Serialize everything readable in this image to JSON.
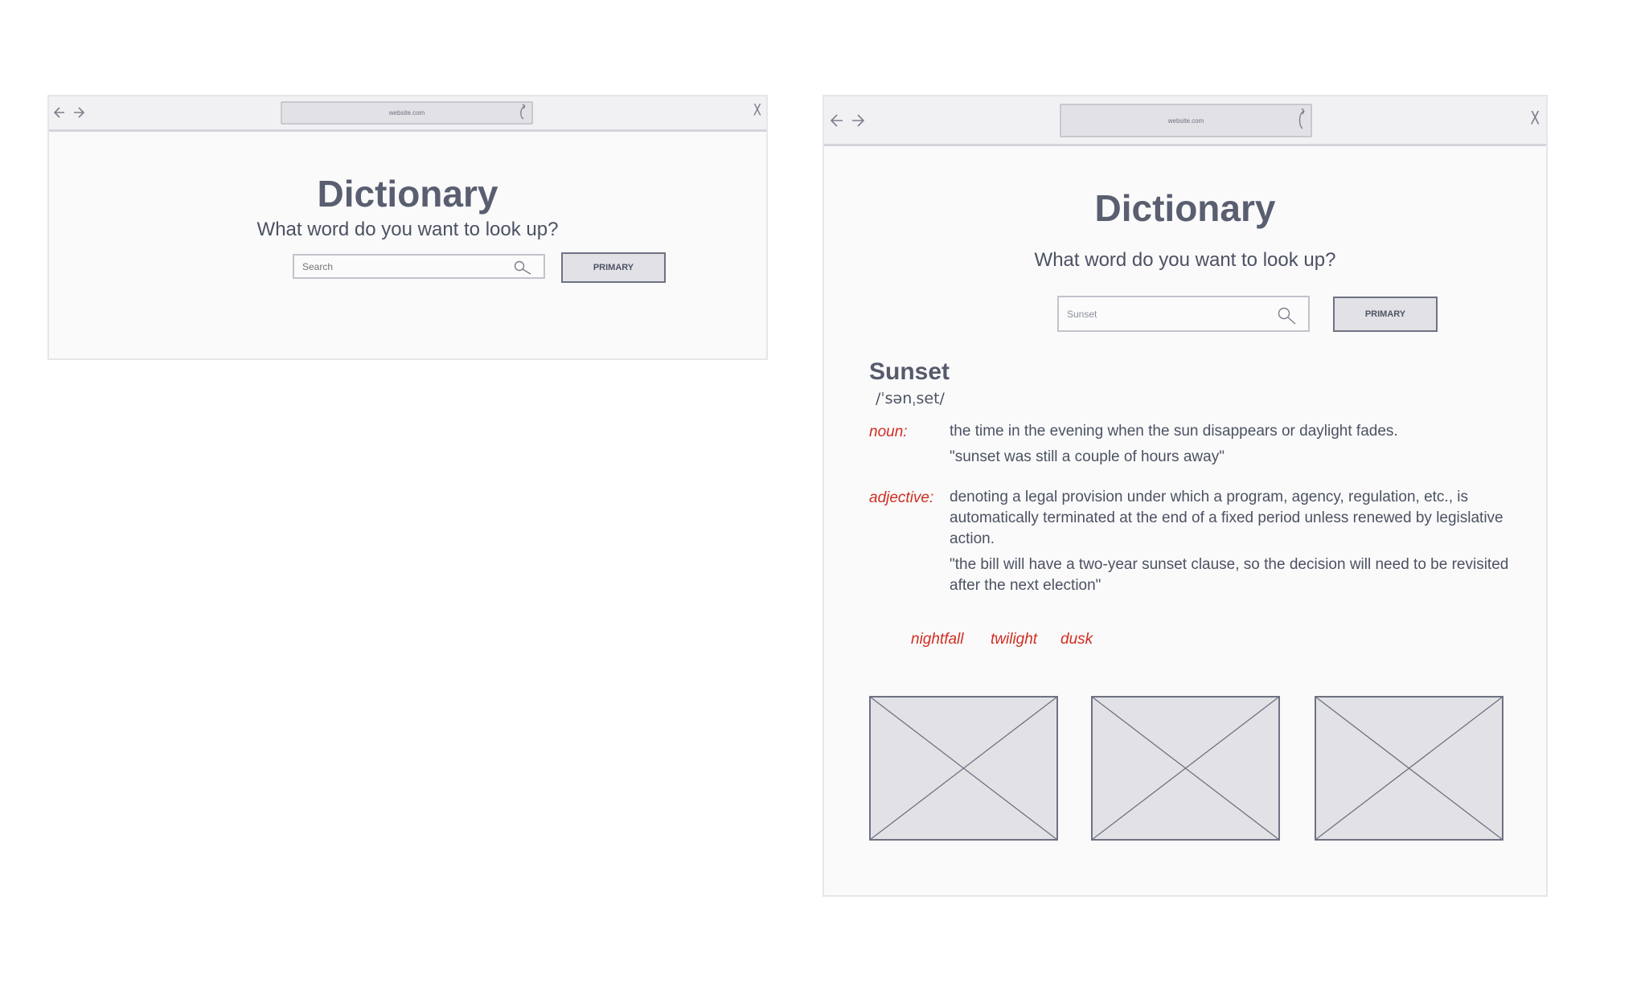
{
  "left_window": {
    "url": "website.com",
    "close_glyph": "X",
    "title": "Dictionary",
    "subtitle": "What word do you want to look up?",
    "search_placeholder": "Search",
    "button_label": "PRIMARY"
  },
  "right_window": {
    "url": "website.com",
    "close_glyph": "X",
    "title": "Dictionary",
    "subtitle": "What word do you want to look up?",
    "search_value": "Sunset",
    "button_label": "PRIMARY",
    "entry": {
      "word": "Sunset",
      "phonetic": "/ˈsənˌset/",
      "senses": [
        {
          "pos": "noun:",
          "definition": "the time in the evening when the sun disappears or daylight fades.",
          "example": "\"sunset was still a couple of hours away\""
        },
        {
          "pos": "adjective:",
          "definition": "denoting a legal provision under which a program, agency, regulation, etc., is automatically terminated at the end of a fixed period unless renewed by legislative action.",
          "example": "\"the bill will have a two-year sunset clause, so the decision will need to be revisited after the next election\""
        }
      ],
      "synonyms": [
        "nightfall",
        "twilight",
        "dusk"
      ]
    },
    "images": [
      "placeholder",
      "placeholder",
      "placeholder"
    ]
  },
  "colors": {
    "part_of_speech": "#cf2e22",
    "heading": "#595e70",
    "body_text": "#4c5263",
    "placeholder_fill": "#e2e2e6"
  },
  "icons": [
    "back-arrow-icon",
    "forward-arrow-icon",
    "reload-icon",
    "close-icon",
    "search-icon",
    "image-placeholder-icon"
  ]
}
